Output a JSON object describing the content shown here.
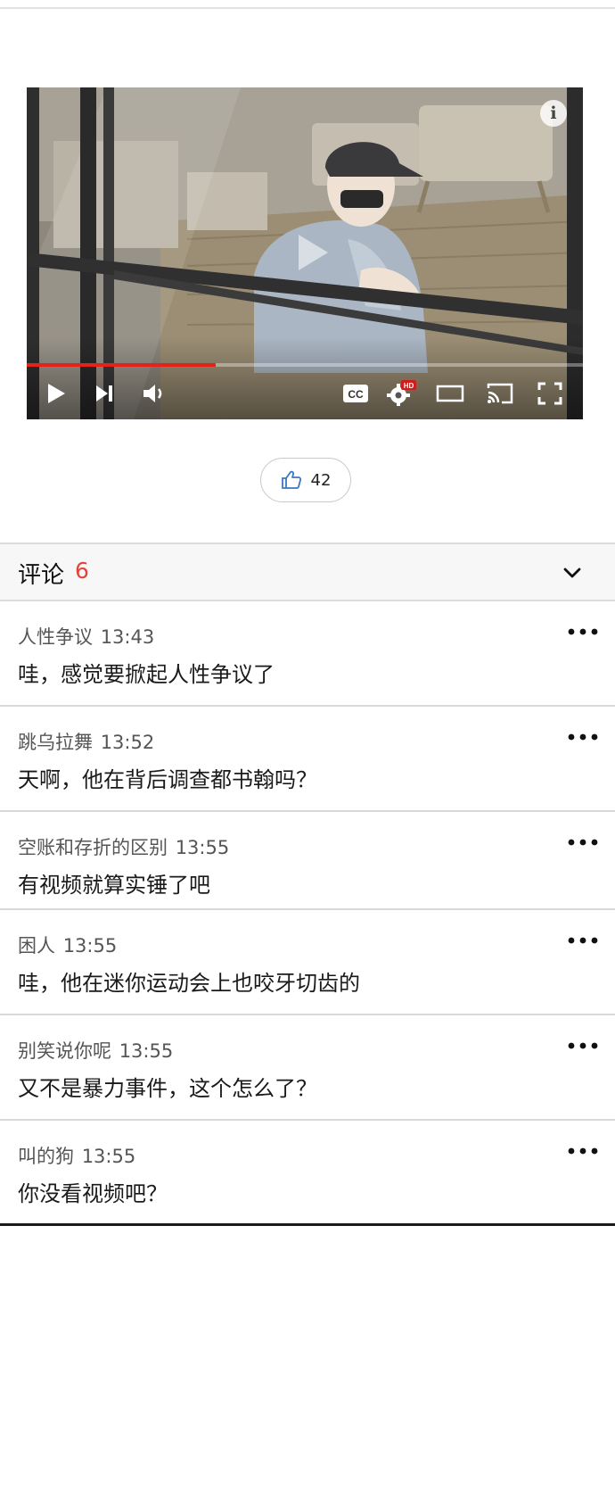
{
  "video": {
    "info_glyph": "i",
    "progress": 0.34,
    "controls": [
      "play-icon",
      "next-icon",
      "volume-icon",
      "captions-icon",
      "settings-hd-icon",
      "theater-mode-icon",
      "cast-icon",
      "fullscreen-icon"
    ],
    "cc_label": "CC",
    "hd_badge": "HD",
    "accent_color": "#e62117"
  },
  "like": {
    "icon": "thumbs-up-icon",
    "count": "42"
  },
  "comments_section": {
    "title": "评论",
    "count": "6",
    "count_color": "#e0453d",
    "toggle_icon": "chevron-down-icon",
    "items": [
      {
        "author": "人性争议",
        "time": "13:43",
        "text": "哇，感觉要掀起人性争议了"
      },
      {
        "author": "跳乌拉舞",
        "time": "13:52",
        "text": "天啊，他在背后调查都书翰吗？"
      },
      {
        "author": "空账和存折的区别",
        "time": "13:55",
        "text": "有视频就算实锤了吧"
      },
      {
        "author": "困人",
        "time": "13:55",
        "text": "哇，他在迷你运动会上也咬牙切齿的"
      },
      {
        "author": "别笑说你呢 ",
        "time": "13:55",
        "text": "又不是暴力事件，这个怎么了？"
      },
      {
        "author": "叫的狗",
        "time": "13:55",
        "text": "你没看视频吧？"
      }
    ]
  }
}
